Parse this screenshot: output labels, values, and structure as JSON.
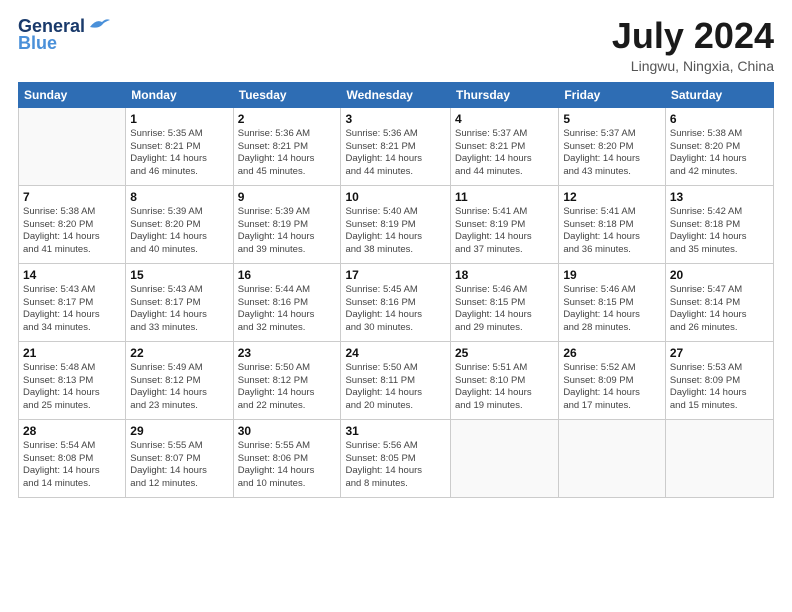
{
  "header": {
    "logo_line1": "General",
    "logo_line2": "Blue",
    "month": "July 2024",
    "location": "Lingwu, Ningxia, China"
  },
  "days_of_week": [
    "Sunday",
    "Monday",
    "Tuesday",
    "Wednesday",
    "Thursday",
    "Friday",
    "Saturday"
  ],
  "weeks": [
    [
      {
        "day": "",
        "info": ""
      },
      {
        "day": "1",
        "info": "Sunrise: 5:35 AM\nSunset: 8:21 PM\nDaylight: 14 hours\nand 46 minutes."
      },
      {
        "day": "2",
        "info": "Sunrise: 5:36 AM\nSunset: 8:21 PM\nDaylight: 14 hours\nand 45 minutes."
      },
      {
        "day": "3",
        "info": "Sunrise: 5:36 AM\nSunset: 8:21 PM\nDaylight: 14 hours\nand 44 minutes."
      },
      {
        "day": "4",
        "info": "Sunrise: 5:37 AM\nSunset: 8:21 PM\nDaylight: 14 hours\nand 44 minutes."
      },
      {
        "day": "5",
        "info": "Sunrise: 5:37 AM\nSunset: 8:20 PM\nDaylight: 14 hours\nand 43 minutes."
      },
      {
        "day": "6",
        "info": "Sunrise: 5:38 AM\nSunset: 8:20 PM\nDaylight: 14 hours\nand 42 minutes."
      }
    ],
    [
      {
        "day": "7",
        "info": "Sunrise: 5:38 AM\nSunset: 8:20 PM\nDaylight: 14 hours\nand 41 minutes."
      },
      {
        "day": "8",
        "info": "Sunrise: 5:39 AM\nSunset: 8:20 PM\nDaylight: 14 hours\nand 40 minutes."
      },
      {
        "day": "9",
        "info": "Sunrise: 5:39 AM\nSunset: 8:19 PM\nDaylight: 14 hours\nand 39 minutes."
      },
      {
        "day": "10",
        "info": "Sunrise: 5:40 AM\nSunset: 8:19 PM\nDaylight: 14 hours\nand 38 minutes."
      },
      {
        "day": "11",
        "info": "Sunrise: 5:41 AM\nSunset: 8:19 PM\nDaylight: 14 hours\nand 37 minutes."
      },
      {
        "day": "12",
        "info": "Sunrise: 5:41 AM\nSunset: 8:18 PM\nDaylight: 14 hours\nand 36 minutes."
      },
      {
        "day": "13",
        "info": "Sunrise: 5:42 AM\nSunset: 8:18 PM\nDaylight: 14 hours\nand 35 minutes."
      }
    ],
    [
      {
        "day": "14",
        "info": "Sunrise: 5:43 AM\nSunset: 8:17 PM\nDaylight: 14 hours\nand 34 minutes."
      },
      {
        "day": "15",
        "info": "Sunrise: 5:43 AM\nSunset: 8:17 PM\nDaylight: 14 hours\nand 33 minutes."
      },
      {
        "day": "16",
        "info": "Sunrise: 5:44 AM\nSunset: 8:16 PM\nDaylight: 14 hours\nand 32 minutes."
      },
      {
        "day": "17",
        "info": "Sunrise: 5:45 AM\nSunset: 8:16 PM\nDaylight: 14 hours\nand 30 minutes."
      },
      {
        "day": "18",
        "info": "Sunrise: 5:46 AM\nSunset: 8:15 PM\nDaylight: 14 hours\nand 29 minutes."
      },
      {
        "day": "19",
        "info": "Sunrise: 5:46 AM\nSunset: 8:15 PM\nDaylight: 14 hours\nand 28 minutes."
      },
      {
        "day": "20",
        "info": "Sunrise: 5:47 AM\nSunset: 8:14 PM\nDaylight: 14 hours\nand 26 minutes."
      }
    ],
    [
      {
        "day": "21",
        "info": "Sunrise: 5:48 AM\nSunset: 8:13 PM\nDaylight: 14 hours\nand 25 minutes."
      },
      {
        "day": "22",
        "info": "Sunrise: 5:49 AM\nSunset: 8:12 PM\nDaylight: 14 hours\nand 23 minutes."
      },
      {
        "day": "23",
        "info": "Sunrise: 5:50 AM\nSunset: 8:12 PM\nDaylight: 14 hours\nand 22 minutes."
      },
      {
        "day": "24",
        "info": "Sunrise: 5:50 AM\nSunset: 8:11 PM\nDaylight: 14 hours\nand 20 minutes."
      },
      {
        "day": "25",
        "info": "Sunrise: 5:51 AM\nSunset: 8:10 PM\nDaylight: 14 hours\nand 19 minutes."
      },
      {
        "day": "26",
        "info": "Sunrise: 5:52 AM\nSunset: 8:09 PM\nDaylight: 14 hours\nand 17 minutes."
      },
      {
        "day": "27",
        "info": "Sunrise: 5:53 AM\nSunset: 8:09 PM\nDaylight: 14 hours\nand 15 minutes."
      }
    ],
    [
      {
        "day": "28",
        "info": "Sunrise: 5:54 AM\nSunset: 8:08 PM\nDaylight: 14 hours\nand 14 minutes."
      },
      {
        "day": "29",
        "info": "Sunrise: 5:55 AM\nSunset: 8:07 PM\nDaylight: 14 hours\nand 12 minutes."
      },
      {
        "day": "30",
        "info": "Sunrise: 5:55 AM\nSunset: 8:06 PM\nDaylight: 14 hours\nand 10 minutes."
      },
      {
        "day": "31",
        "info": "Sunrise: 5:56 AM\nSunset: 8:05 PM\nDaylight: 14 hours\nand 8 minutes."
      },
      {
        "day": "",
        "info": ""
      },
      {
        "day": "",
        "info": ""
      },
      {
        "day": "",
        "info": ""
      }
    ]
  ]
}
